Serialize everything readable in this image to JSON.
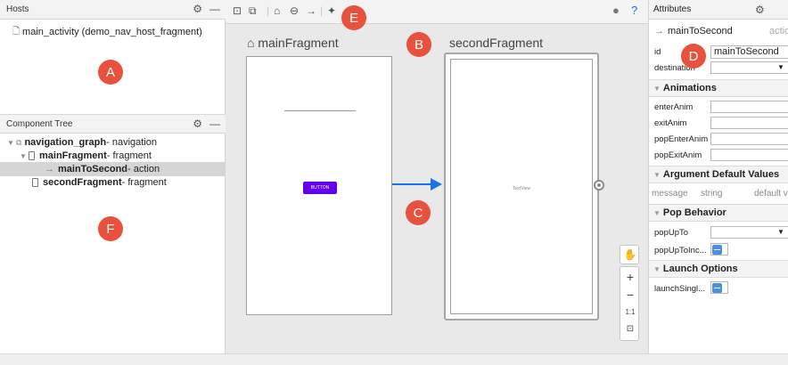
{
  "hosts_panel": {
    "title": "Hosts",
    "items": [
      {
        "label": "main_activity (demo_nav_host_fragment)"
      }
    ]
  },
  "component_tree": {
    "title": "Component Tree",
    "items": [
      {
        "name": "navigation_graph",
        "type": " - navigation"
      },
      {
        "name": "mainFragment",
        "type": " - fragment"
      },
      {
        "name": "mainToSecond",
        "type": " - action"
      },
      {
        "name": "secondFragment",
        "type": " - fragment"
      }
    ]
  },
  "canvas": {
    "destinations": [
      {
        "title": "mainFragment",
        "button_label": "BUTTON"
      },
      {
        "title": "secondFragment",
        "text_view": "TextView"
      }
    ],
    "zoom_controls": [
      "+",
      "−",
      "1:1"
    ]
  },
  "attributes": {
    "title": "Attributes",
    "selected_name": "mainToSecond",
    "selected_type": "action",
    "id_label": "id",
    "id_value": "mainToSecond",
    "destination_label": "destination",
    "sections": {
      "animations": "Animations",
      "argument_defaults": "Argument Default Values",
      "pop_behavior": "Pop Behavior",
      "launch_options": "Launch Options"
    },
    "anim_fields": [
      "enterAnim",
      "exitAnim",
      "popEnterAnim",
      "popExitAnim"
    ],
    "argument_columns": [
      "message",
      "string",
      "default v"
    ],
    "pop_up_to_label": "popUpTo",
    "pop_up_inclusive_label": "popUpToInc...",
    "launch_single_top_label": "launchSingl..."
  },
  "badges": [
    "A",
    "B",
    "C",
    "D",
    "E",
    "F"
  ],
  "colors": {
    "badge": "#e8513c",
    "accent": "#1a73e8",
    "button": "#6200ee",
    "checkbox": "#4a8fe0"
  }
}
